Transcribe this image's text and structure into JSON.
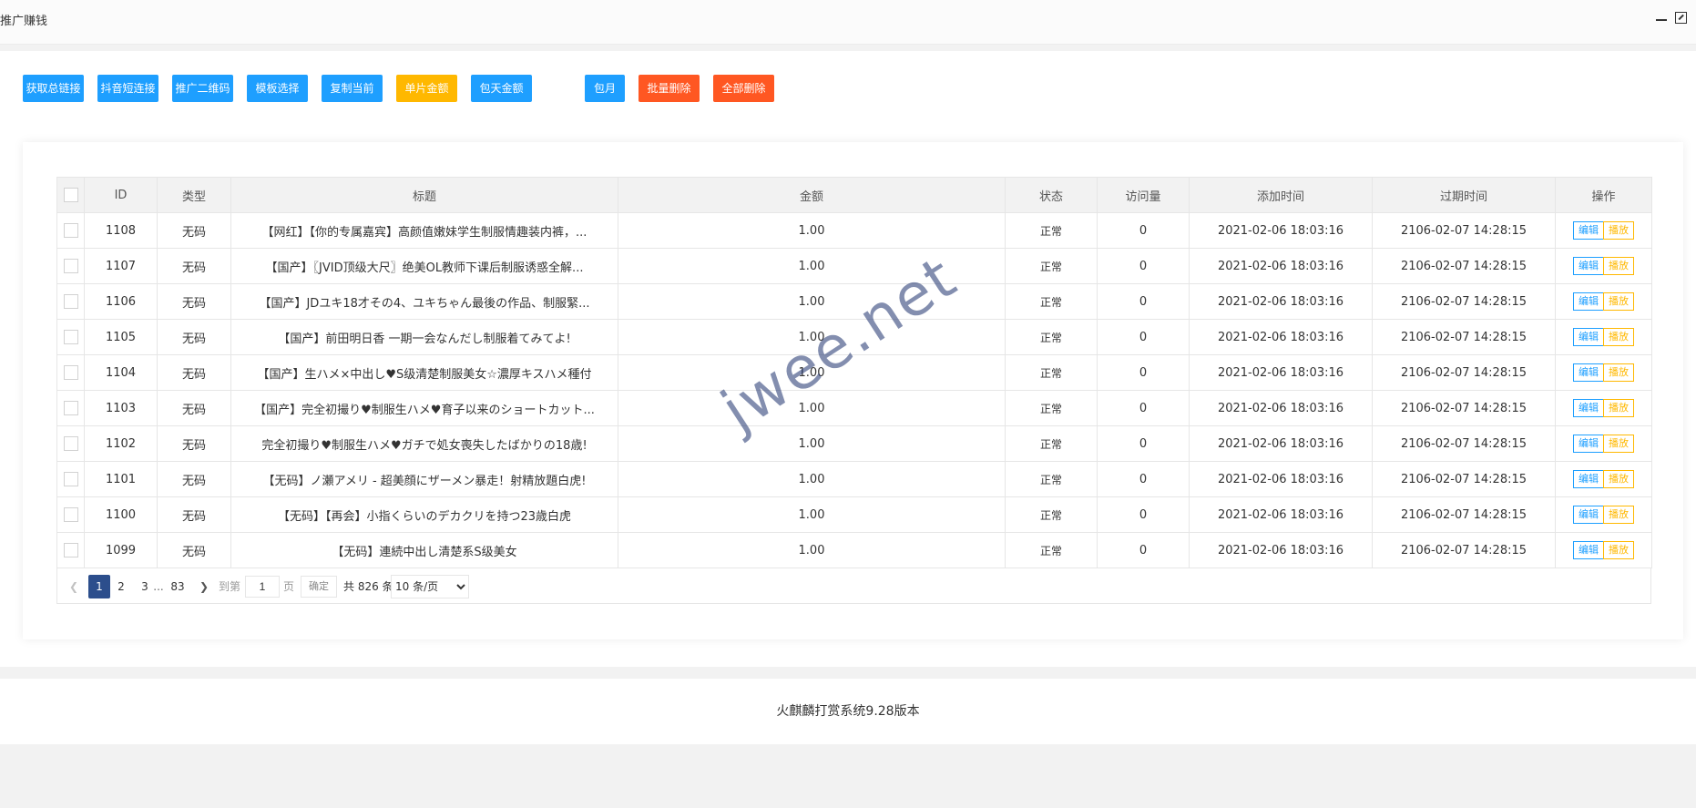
{
  "window": {
    "title": "推广赚钱",
    "minimize_icon": "minimize-icon",
    "maximize_icon": "maximize-icon"
  },
  "toolbar": {
    "buttons": [
      {
        "label": "获取总链接",
        "color": "#1e9fff"
      },
      {
        "label": "抖音短连接",
        "color": "#1e9fff"
      },
      {
        "label": "推广二维码",
        "color": "#1e9fff"
      },
      {
        "label": "模板选择",
        "color": "#1e9fff"
      },
      {
        "label": "复制当前",
        "color": "#1e9fff"
      },
      {
        "label": "单片金额",
        "color": "#ffb800"
      },
      {
        "label": "包天金额",
        "color": "#1e9fff"
      },
      {
        "label": "包月",
        "color": "#1e9fff"
      },
      {
        "label": "批量删除",
        "color": "#ff5722"
      },
      {
        "label": "全部删除",
        "color": "#ff5722"
      }
    ]
  },
  "table": {
    "headers": [
      "ID",
      "类型",
      "标题",
      "金额",
      "状态",
      "访问量",
      "添加时间",
      "过期时间",
      "操作"
    ],
    "rows": [
      {
        "id": "1108",
        "type": "无码",
        "title": "【网红】【你的专属嘉宾】高颜值嫩妹学生制服情趣装内裤，...",
        "amount": "1.00",
        "status": "正常",
        "views": "0",
        "added": "2021-02-06 18:03:16",
        "expires": "2106-02-07 14:28:15"
      },
      {
        "id": "1107",
        "type": "无码",
        "title": "【国产】〖JVID顶级大尺〗绝美OL教师下课后制服诱惑全解...",
        "amount": "1.00",
        "status": "正常",
        "views": "0",
        "added": "2021-02-06 18:03:16",
        "expires": "2106-02-07 14:28:15"
      },
      {
        "id": "1106",
        "type": "无码",
        "title": "【国产】JDユキ18才その4、ユキちゃん最後の作品、制服緊...",
        "amount": "1.00",
        "status": "正常",
        "views": "0",
        "added": "2021-02-06 18:03:16",
        "expires": "2106-02-07 14:28:15"
      },
      {
        "id": "1105",
        "type": "无码",
        "title": "【国产】前田明日香 一期一会なんだし制服着てみてよ!",
        "amount": "1.00",
        "status": "正常",
        "views": "0",
        "added": "2021-02-06 18:03:16",
        "expires": "2106-02-07 14:28:15"
      },
      {
        "id": "1104",
        "type": "无码",
        "title": "【国产】生ハメ×中出し♥S级清楚制服美女☆濃厚キスハメ種付",
        "amount": "1.00",
        "status": "正常",
        "views": "0",
        "added": "2021-02-06 18:03:16",
        "expires": "2106-02-07 14:28:15"
      },
      {
        "id": "1103",
        "type": "无码",
        "title": "【国产】完全初撮り♥制服生ハメ♥育子以来のショートカット...",
        "amount": "1.00",
        "status": "正常",
        "views": "0",
        "added": "2021-02-06 18:03:16",
        "expires": "2106-02-07 14:28:15"
      },
      {
        "id": "1102",
        "type": "无码",
        "title": "完全初撮り♥制服生ハメ♥ガチで処女喪失したばかりの18歳!",
        "amount": "1.00",
        "status": "正常",
        "views": "0",
        "added": "2021-02-06 18:03:16",
        "expires": "2106-02-07 14:28:15"
      },
      {
        "id": "1101",
        "type": "无码",
        "title": "【无码】ノ瀬アメリ - 超美顔にザーメン暴走！射精放題白虎!",
        "amount": "1.00",
        "status": "正常",
        "views": "0",
        "added": "2021-02-06 18:03:16",
        "expires": "2106-02-07 14:28:15"
      },
      {
        "id": "1100",
        "type": "无码",
        "title": "【无码】【再会】小指くらいのデカクリを持つ23歳白虎",
        "amount": "1.00",
        "status": "正常",
        "views": "0",
        "added": "2021-02-06 18:03:16",
        "expires": "2106-02-07 14:28:15"
      },
      {
        "id": "1099",
        "type": "无码",
        "title": "【无码】連続中出し清楚系S级美女",
        "amount": "1.00",
        "status": "正常",
        "views": "0",
        "added": "2021-02-06 18:03:16",
        "expires": "2106-02-07 14:28:15"
      }
    ],
    "row_actions": {
      "edit": "编辑",
      "play": "播放"
    }
  },
  "pagination": {
    "pages": [
      "1",
      "2",
      "3"
    ],
    "ellipsis": "...",
    "last_page": "83",
    "goto_label": "到第",
    "page_input_value": "1",
    "page_unit": "页",
    "confirm_label": "确定",
    "total_label": "共 826 条",
    "page_size_options": [
      "10 条/页"
    ]
  },
  "footer": {
    "text": "火麒麟打赏系统9.28版本"
  },
  "watermark": {
    "text": "jwee.net"
  },
  "colors": {
    "blue": "#1e9fff",
    "yellow": "#ffb800",
    "red": "#ff5722",
    "status_green": "#5fb878",
    "page_active": "#2c4e8c"
  }
}
